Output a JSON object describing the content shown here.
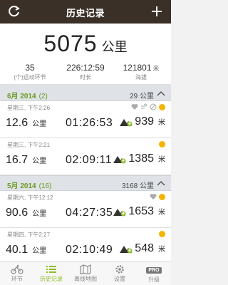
{
  "header": {
    "title": "历史记录"
  },
  "summary": {
    "total": "5075",
    "unit": "公里",
    "stats": [
      {
        "value": "35",
        "unit": "",
        "label": "(个)运动环节"
      },
      {
        "value": "226:12:59",
        "unit": "",
        "label": "时长"
      },
      {
        "value": "121801",
        "unit": "米",
        "label": "海拔"
      }
    ]
  },
  "months": [
    {
      "month": "6月 2014",
      "count": "(2)",
      "distance": "29 公里",
      "records": [
        {
          "date": "星期三, 下午2:26",
          "distance": "12.6",
          "dist_unit": "公里",
          "time": "01:26:53",
          "climb": "939",
          "climb_unit": "米",
          "icons": [
            "heart-icon",
            "wind-icon",
            "cancel-icon",
            "dot-icon"
          ]
        },
        {
          "date": "星期三, 下午2:21",
          "distance": "16.7",
          "dist_unit": "公里",
          "time": "02:09:11",
          "climb": "1385",
          "climb_unit": "米",
          "icons": [
            "dot-icon"
          ]
        }
      ]
    },
    {
      "month": "5月 2014",
      "count": "(16)",
      "distance": "3168 公里",
      "records": [
        {
          "date": "星期六, 下午12:12",
          "distance": "90.6",
          "dist_unit": "公里",
          "time": "04:27:35",
          "climb": "1653",
          "climb_unit": "米",
          "icons": [
            "heart-icon",
            "dot-icon"
          ]
        },
        {
          "date": "星期四, 下午2:27",
          "distance": "40.1",
          "dist_unit": "公里",
          "time": "02:10:49",
          "climb": "548",
          "climb_unit": "米",
          "icons": [
            "dot-icon"
          ]
        }
      ]
    }
  ],
  "tabs": [
    {
      "label": "环节",
      "icon": "bike-icon",
      "active": false
    },
    {
      "label": "历史记录",
      "icon": "list-icon",
      "active": true
    },
    {
      "label": "离线地图",
      "icon": "map-icon",
      "active": false
    },
    {
      "label": "设置",
      "icon": "gear-icon",
      "active": false
    },
    {
      "label": "升级",
      "icon": "pro-icon",
      "badge": "PRO",
      "active": false
    }
  ],
  "colors": {
    "header": "#3a3028",
    "accent": "#8cbf26",
    "dot": "#f4b400"
  }
}
